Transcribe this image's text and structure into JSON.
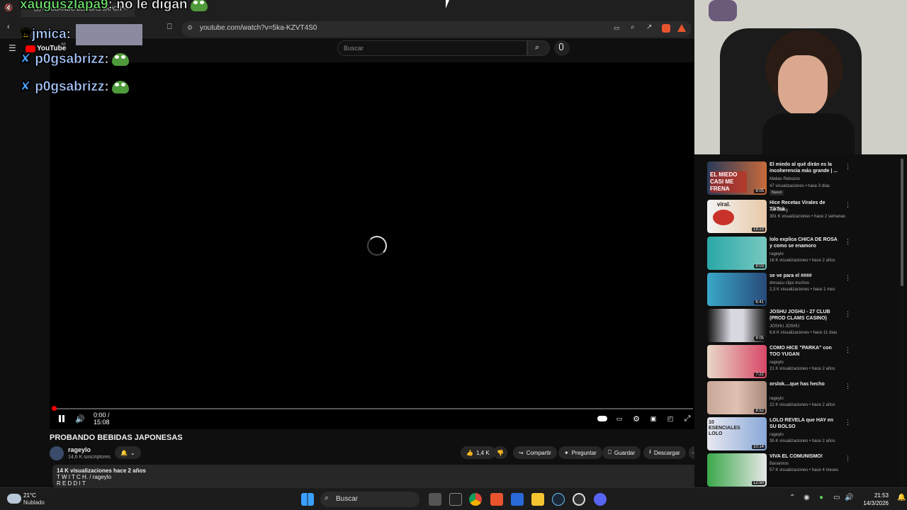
{
  "browser": {
    "tab_title": "(1) PROBANDO BEBIDAS JAPON",
    "url": "youtube.com/watch?v=5ka-KZVT4S0"
  },
  "youtube": {
    "logo_text": "YouTube",
    "logo_region": "AR",
    "search_placeholder": "Buscar"
  },
  "player": {
    "time_display": "0:00 / 15:08",
    "progress": 0
  },
  "video": {
    "title": "PROBANDO BEBIDAS JAPONESAS",
    "channel": "rageylo",
    "subscribers": "14,6 K suscriptores",
    "likes": "1,4 K",
    "actions": {
      "share": "Compartir",
      "ask": "Preguntar",
      "save": "Guardar",
      "download": "Descargar"
    },
    "description_stats": "14 K visualizaciones  hace 2 años",
    "description_line1": "T W I T C H.  / rageylo",
    "description_line2": "R E D D I T"
  },
  "chat": [
    {
      "user": "xauguszlapa9",
      "message": ": no le digan",
      "color": "#6ee36e"
    },
    {
      "user": "jmica",
      "message": ":",
      "color": "#a9c8ff"
    },
    {
      "user": "p0gsabrizz",
      "message": ":",
      "color": "#a9c8ff"
    },
    {
      "user": "p0gsabrizz",
      "message": ":",
      "color": "#a9c8ff"
    }
  ],
  "recommendations": [
    {
      "title": "El miedo al qué dirán es la incoherencia más grande | ...",
      "channel": "Matias Rebozov",
      "meta": "47 visualizaciones • hace 3 días",
      "duration": "8:05",
      "badge": "Nuevo",
      "thumb_text": "EL MIEDO CASI ME FRENA"
    },
    {
      "title": "Hice Recetas Virales de TikTok",
      "channel": "Ale Wang",
      "meta": "381 K visualizaciones • hace 2 semanas",
      "duration": "19:23",
      "thumb_text": "viral."
    },
    {
      "title": "lolo explica CHICA DE ROSA y como se enamoro",
      "channel": "rageylo",
      "meta": "16 K visualizaciones • hace 2 años",
      "duration": "8:03"
    },
    {
      "title": "se ve para el ####",
      "channel": "dmsazu clips truchos",
      "meta": "2,3 K visualizaciones • hace 1 mes",
      "duration": "6:41"
    },
    {
      "title": "JOSHU JOSHU - 27 CLUB (PROD CLAMS CASINO)",
      "channel": "JOSHU JOSHU",
      "meta": "6,6 K visualizaciones • hace 11 días",
      "duration": "4:05"
    },
    {
      "title": "COMO HICE \"PARKA\" con TOO YUGAN",
      "channel": "rageylo",
      "meta": "21 K visualizaciones • hace 2 años",
      "duration": "7:22"
    },
    {
      "title": "orslok....que has hecho",
      "channel": "rageylo",
      "meta": "22 K visualizaciones • hace 2 años",
      "duration": "8:52"
    },
    {
      "title": "LOLO REVELA que HAY en SU BOLSO",
      "channel": "rageylo",
      "meta": "35 K visualizaciones • hace 2 años",
      "duration": "10:14",
      "thumb_text": "10 ESENCIALES LOLO"
    },
    {
      "title": "VIVA EL COMUNISMO!",
      "channel": "Bananiros",
      "meta": "57 K visualizaciones • hace 4 meses",
      "duration": "12:50"
    }
  ],
  "taskbar": {
    "weather_temp": "21°C",
    "weather_desc": "Nublado",
    "search_label": "Buscar",
    "time": "21:53",
    "date": "14/3/2026"
  },
  "colors": {
    "progress_red": "#ff0000",
    "youtube_red": "#ff0000"
  }
}
